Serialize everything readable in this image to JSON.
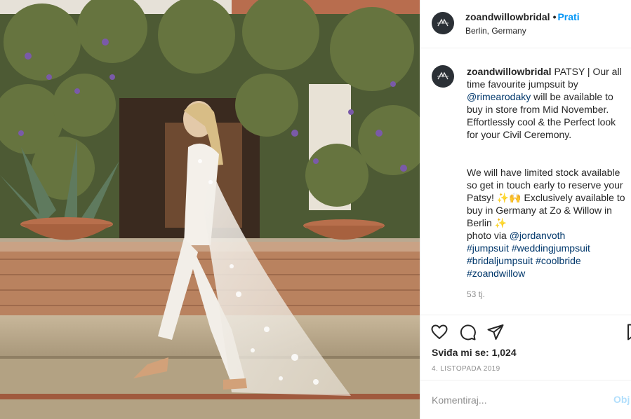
{
  "post": {
    "username": "zoandwillowbridal",
    "follow_separator": "•",
    "follow_label": "Prati",
    "location": "Berlin, Germany",
    "caption": {
      "username": "zoandwillowbridal",
      "line1_text": " PATSY | Our all time favourite jumpsuit by ",
      "mention1": "@rimearodaky",
      "line1_rest": " will be available to buy in store from Mid November. Effortlessly cool & the Perfect look for your Civil Ceremony.",
      "para2": "We will have limited stock available so get in touch early to reserve your Patsy! ✨🙌 Exclusively available to buy in Germany at Zo & Willow in Berlin ✨",
      "photo_prefix": "photo via ",
      "mention2": "@jordanvoth",
      "hashtags": [
        "#jumpsuit",
        "#weddingjumpsuit",
        "#bridaljumpsuit",
        "#coolbride",
        "#zoandwillow"
      ],
      "time_ago": "53 tj."
    },
    "likes_text": "Sviđa mi se: 1,024",
    "date": "4. listopada 2019",
    "comment_placeholder": "Komentiraj...",
    "post_button": "Obj"
  },
  "icons": {
    "like": "heart-icon",
    "comment": "comment-bubble-icon",
    "share": "share-paper-plane-icon",
    "save": "bookmark-icon",
    "avatar": "zo-willow-logo-icon"
  },
  "colors": {
    "follow_blue": "#0095f6",
    "link_blue": "#00376b",
    "muted": "#8e8e8e",
    "post_disabled": "#b2dffc"
  }
}
